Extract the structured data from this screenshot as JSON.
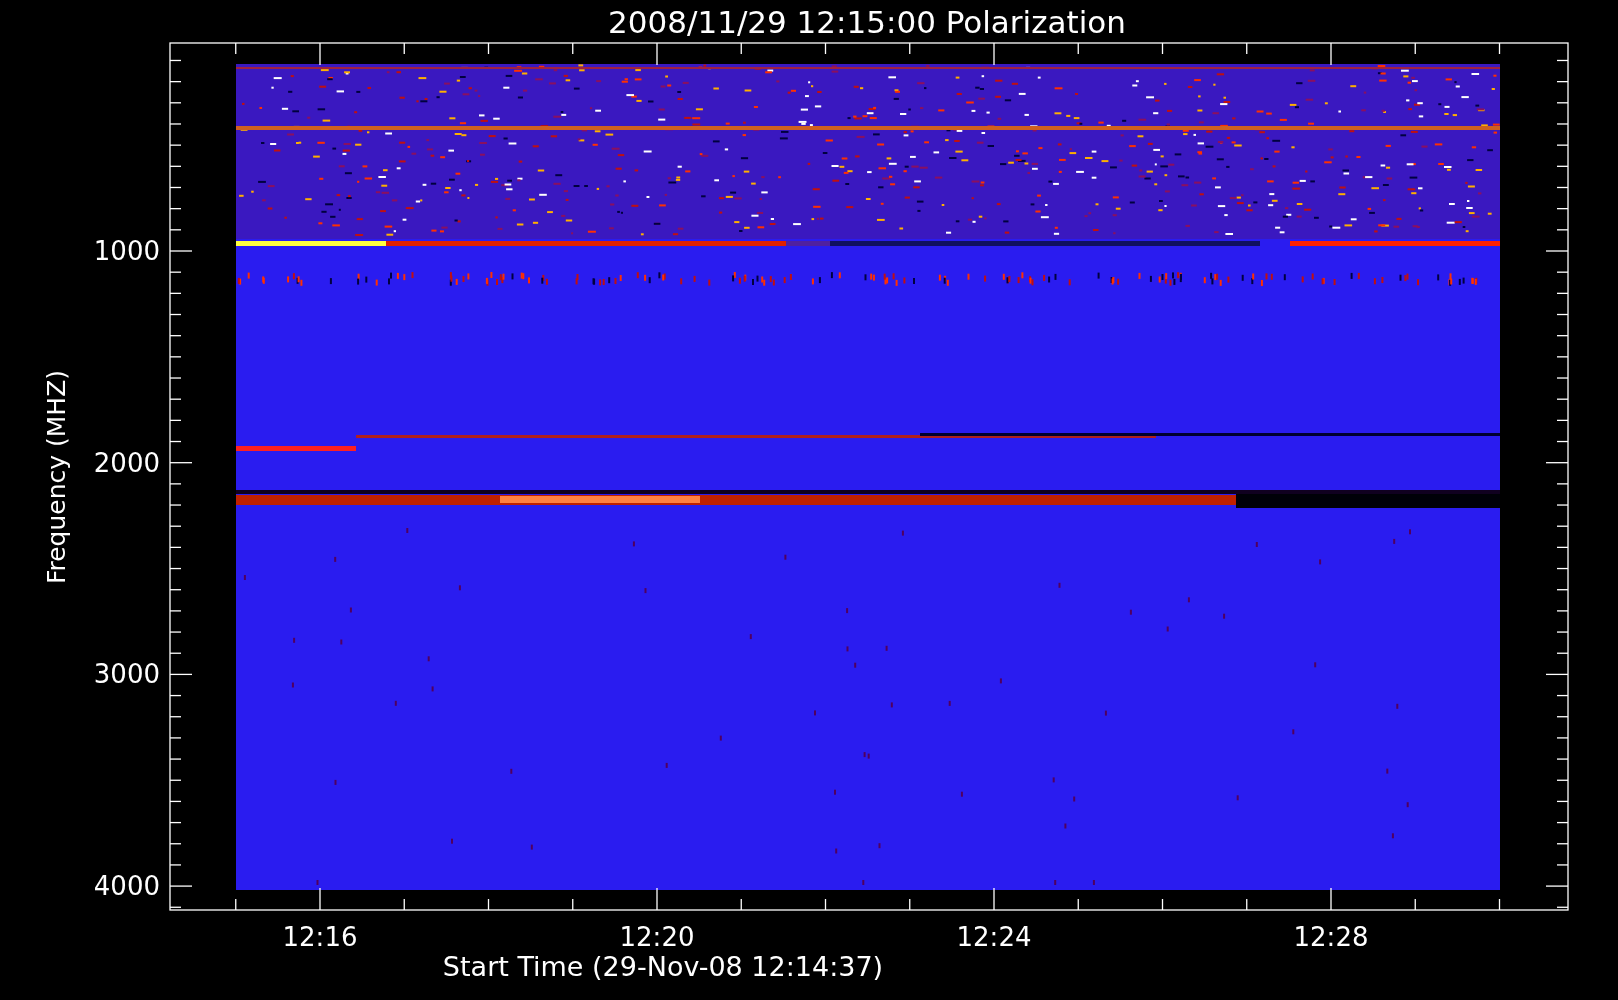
{
  "title": "2008/11/29 12:15:00 Polarization",
  "ylabel": "Frequency (MHZ)",
  "xlabel": "Start Time (29-Nov-08 12:14:37)",
  "yticks": [
    "1000",
    "2000",
    "3000",
    "4000"
  ],
  "xticks": [
    "12:16",
    "12:20",
    "12:24",
    "12:28"
  ]
}
